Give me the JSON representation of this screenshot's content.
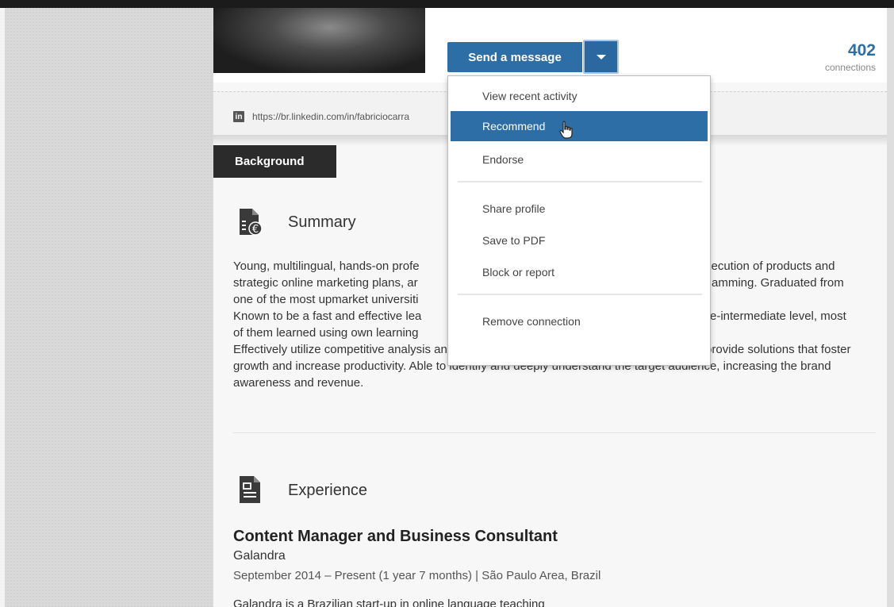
{
  "header": {
    "send_message_label": "Send a message",
    "connections_count": "402",
    "connections_label": "connections",
    "profile_url": "https://br.linkedin.com/in/fabriciocarra",
    "linkedin_badge": "in"
  },
  "menu": {
    "items": [
      {
        "label": "View recent activity"
      },
      {
        "label": "Recommend"
      },
      {
        "label": "Endorse"
      },
      {
        "label": "Share profile"
      },
      {
        "label": "Save to PDF"
      },
      {
        "label": "Block or report"
      },
      {
        "label": "Remove connection"
      }
    ],
    "active_item": "Recommend"
  },
  "tabs": {
    "background_label": "Background"
  },
  "summary": {
    "title": "Summary",
    "lines": [
      "Young, multilingual, hands-on profe",
      "strategic online marketing plans, ar",
      "one of the most upmarket universiti",
      "Known to be a fast and effective lea",
      "of them learned using own learning"
    ],
    "lines_right": [
      "xecution of products and",
      "amming. Graduated from",
      "",
      "re-intermediate level, most",
      ""
    ],
    "paragraph2": "Effectively utilize competitive analysis and market research to assess business plans and provide solutions that foster growth and increase productivity. Able to identify and deeply understand the target audience, increasing the brand awareness and revenue."
  },
  "experience": {
    "title": "Experience",
    "job_title": "Content Manager and Business Consultant",
    "company": "Galandra",
    "dates": "September 2014 – Present (1 year 7 months)  |  São Paulo Area, Brazil",
    "description": "Galandra is a Brazilian start-up in online language teaching"
  },
  "colors": {
    "accent": "#2e6ea6",
    "tab_dark": "#2b2b2b"
  },
  "icons": {
    "summary": "document-euro-icon",
    "experience": "document-briefcase-icon",
    "cursor": "hand-pointer-icon"
  }
}
